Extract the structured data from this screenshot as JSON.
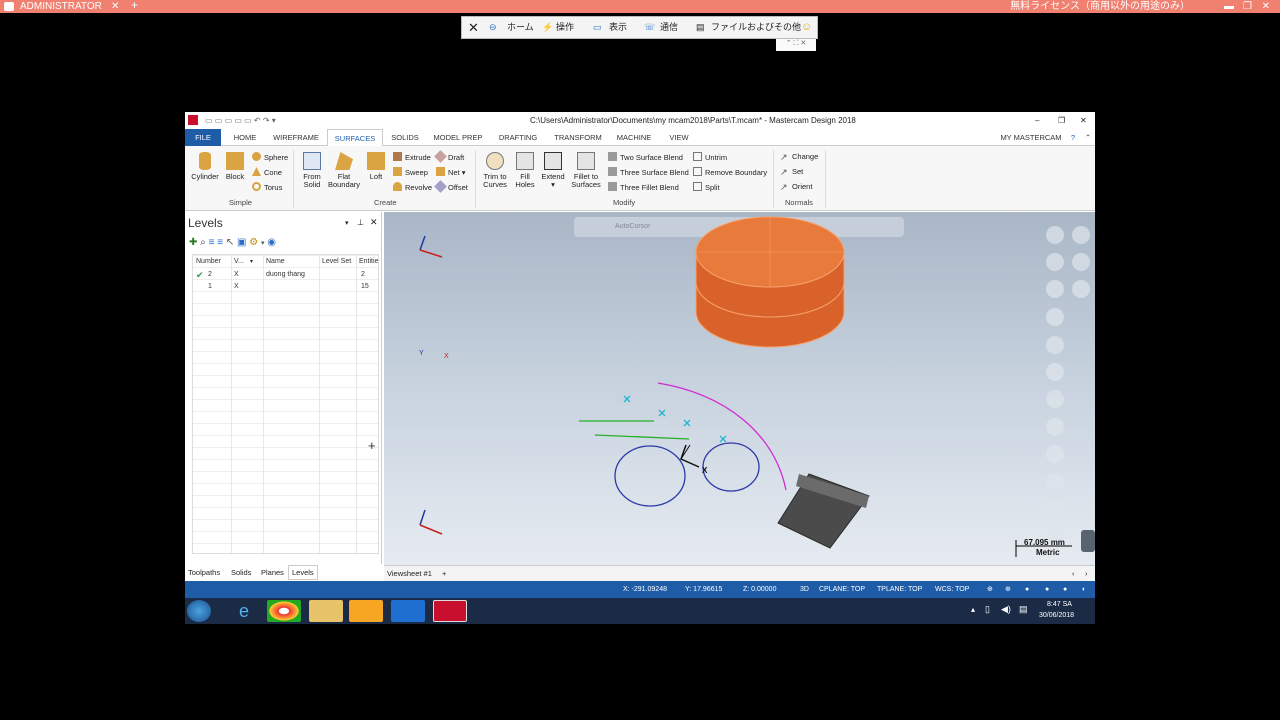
{
  "remote": {
    "user": "ADMINISTRATOR",
    "license": "無料ライセンス（商用以外の用途のみ）"
  },
  "rc_toolbar": {
    "home": "ホーム",
    "ops": "操作",
    "view": "表示",
    "comm": "通信",
    "files": "ファイルおよびその他"
  },
  "app": {
    "title": "C:\\Users\\Administrator\\Documents\\my mcam2018\\Parts\\T.mcam* - Mastercam Design 2018",
    "my_mastercam": "MY MASTERCAM",
    "tabs": [
      "FILE",
      "HOME",
      "WIREFRAME",
      "SURFACES",
      "SOLIDS",
      "MODEL PREP",
      "DRAFTING",
      "TRANSFORM",
      "MACHINE",
      "VIEW"
    ],
    "active_tab": "SURFACES"
  },
  "ribbon": {
    "simple": {
      "label": "Simple",
      "cylinder": "Cylinder",
      "block": "Block",
      "sphere": "Sphere",
      "cone": "Cone",
      "torus": "Torus"
    },
    "create": {
      "label": "Create",
      "from_solid_1": "From",
      "from_solid_2": "Solid",
      "flat_boundary_1": "Flat",
      "flat_boundary_2": "Boundary",
      "loft": "Loft",
      "extrude": "Extrude",
      "sweep": "Sweep",
      "revolve": "Revolve",
      "draft": "Draft",
      "net": "Net",
      "offset": "Offset"
    },
    "modify": {
      "label": "Modify",
      "trim_1": "Trim to",
      "trim_2": "Curves",
      "fill_1": "Fill",
      "fill_2": "Holes",
      "extend": "Extend",
      "fillet_1": "Fillet to",
      "fillet_2": "Surfaces",
      "two_blend": "Two Surface Blend",
      "three_blend": "Three Surface Blend",
      "three_fillet": "Three Fillet Blend",
      "untrim": "Untrim",
      "remove_boundary": "Remove Boundary",
      "split": "Split"
    },
    "normals": {
      "label": "Normals",
      "change": "Change",
      "set": "Set",
      "orient": "Orient"
    }
  },
  "levels": {
    "title": "Levels",
    "columns": [
      "Number",
      "V...",
      "Name",
      "Level Set",
      "Entitie"
    ],
    "rows": [
      {
        "number": "2",
        "visible": "X",
        "name": "duong thang",
        "set": "",
        "entities": "2"
      },
      {
        "number": "1",
        "visible": "X",
        "name": "",
        "set": "",
        "entities": "15"
      }
    ]
  },
  "bottom_tabs": [
    "Toolpaths",
    "Solids",
    "Planes",
    "Levels"
  ],
  "viewport": {
    "scale": "67.095 mm",
    "units": "Metric",
    "axis_x": "X",
    "axis_y": "Y",
    "autocursor": "AutoCursor"
  },
  "viewsheet": "Viewsheet #1",
  "status": {
    "x": "X:   -291.09248",
    "y": "Y:   17.96615",
    "z": "Z:   0.00000",
    "mode": "3D",
    "cplane": "CPLANE: TOP",
    "tplane": "TPLANE: TOP",
    "wcs": "WCS: TOP"
  },
  "clock": {
    "time": "8:47 SA",
    "date": "30/06/2018"
  },
  "colors": {
    "accent": "#1e5ca8",
    "remote_bar": "#f08070",
    "cylinder": "#e06a2c"
  }
}
